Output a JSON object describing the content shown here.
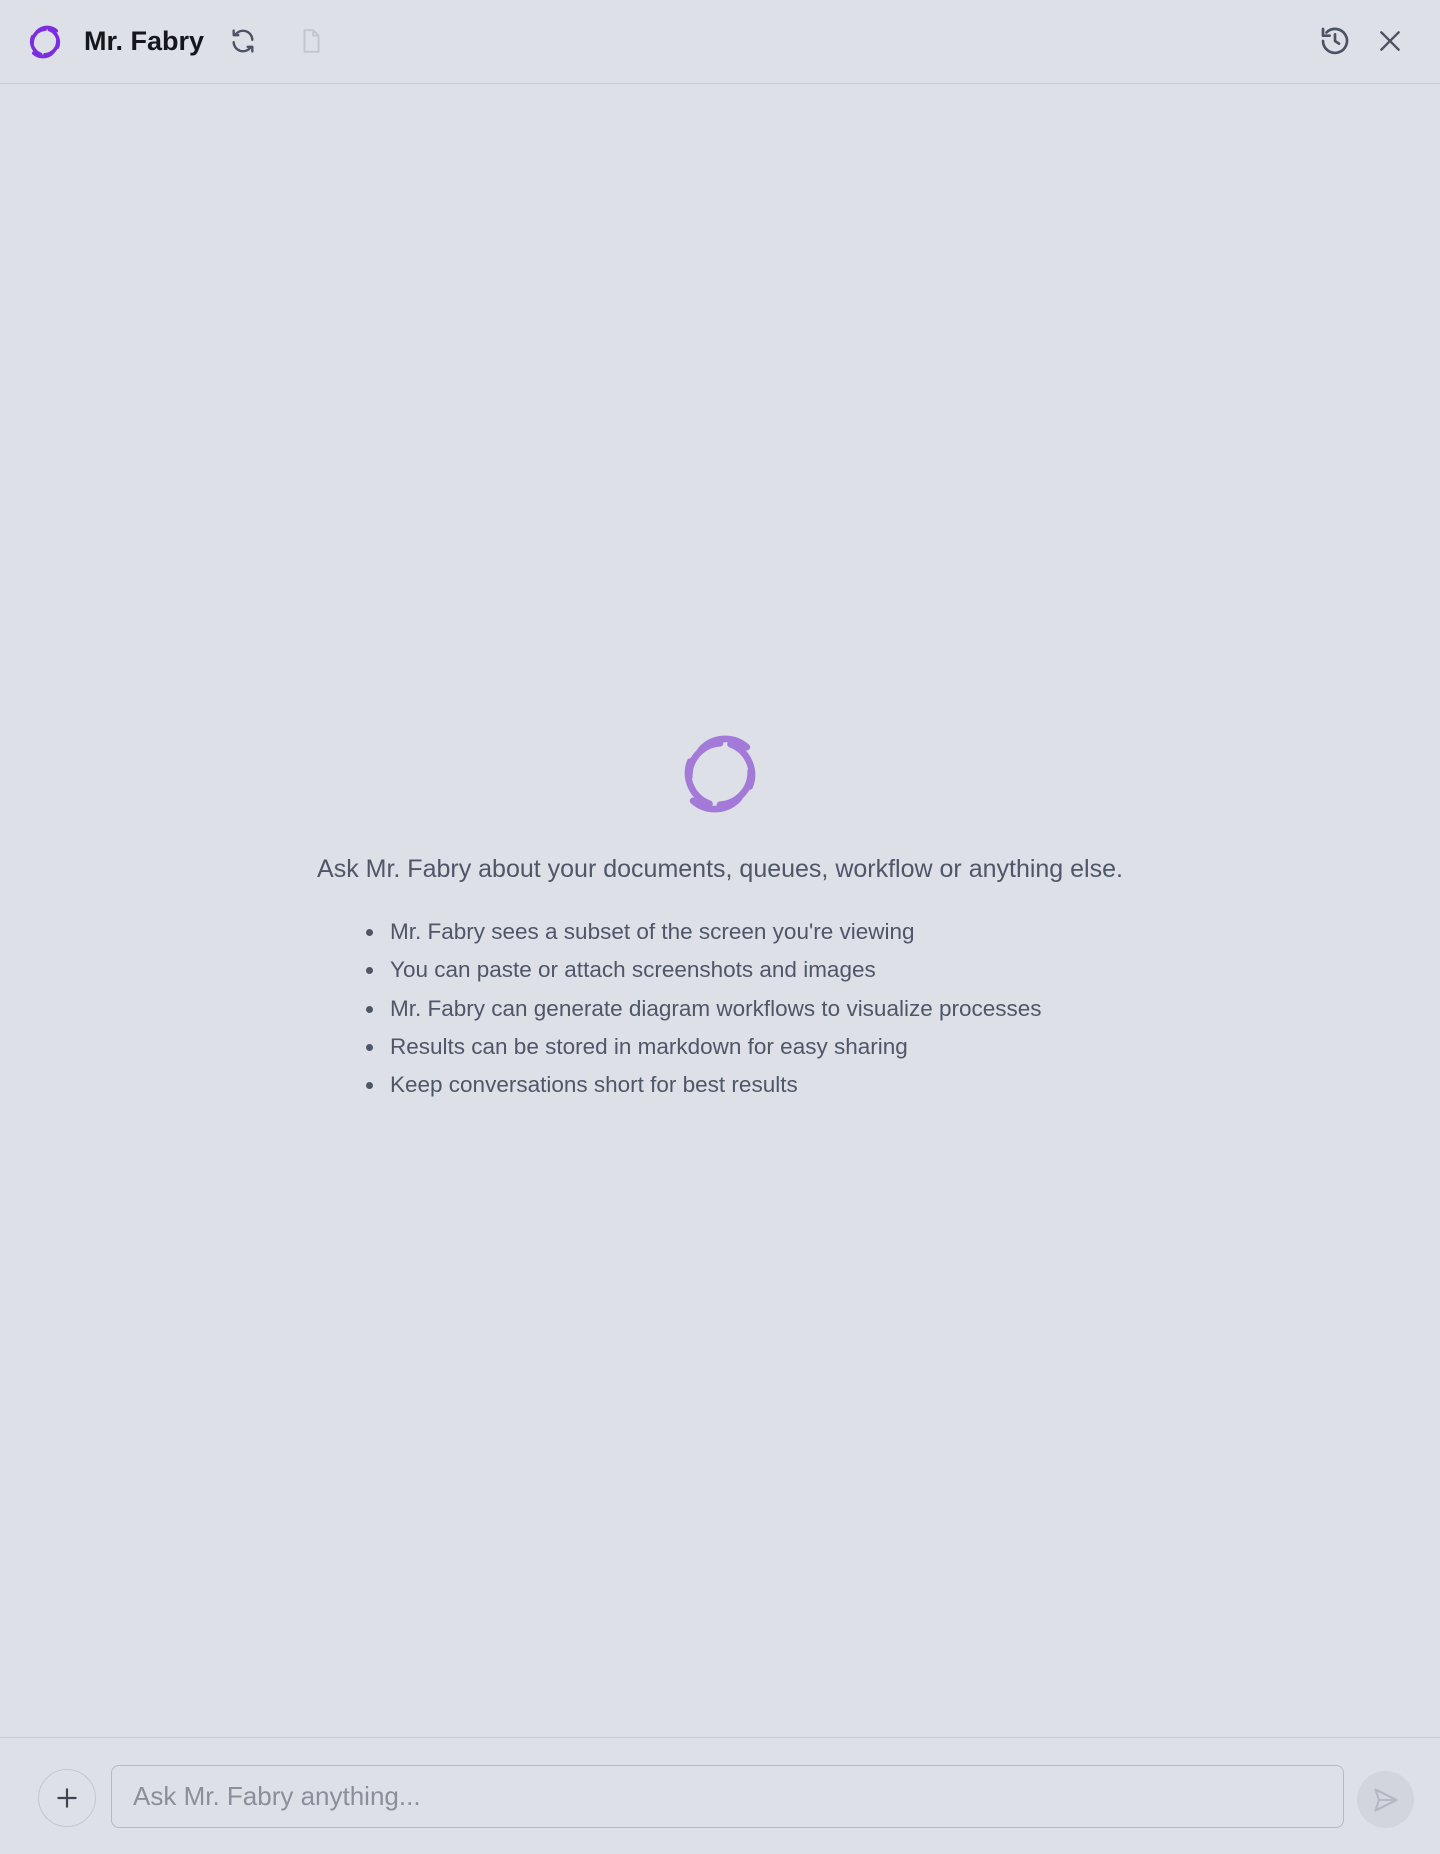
{
  "header": {
    "title": "Mr. Fabry",
    "icons": [
      "fabry-logo-icon",
      "refresh-icon",
      "document-icon",
      "history-icon",
      "close-icon"
    ]
  },
  "empty_state": {
    "intro": "Ask Mr. Fabry about your documents, queues, workflow or anything else.",
    "tips": [
      "Mr. Fabry sees a subset of the screen you're viewing",
      "You can paste or attach screenshots and images",
      "Mr. Fabry can generate diagram workflows to visualize processes",
      "Results can be stored in markdown for easy sharing",
      "Keep conversations short for best results"
    ]
  },
  "composer": {
    "placeholder": "Ask Mr. Fabry anything...",
    "value": ""
  },
  "colors": {
    "background": "#dee0e8",
    "brand_purple": "#7a2ee0",
    "brand_purple_light": "#a47ad9"
  }
}
